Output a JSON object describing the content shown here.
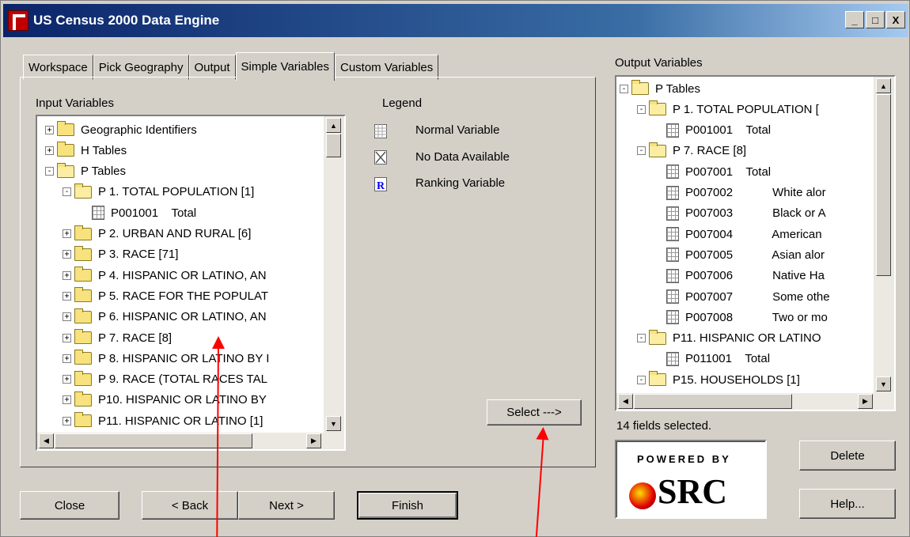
{
  "window": {
    "title": "US Census 2000 Data Engine",
    "btn_min": "_",
    "btn_max": "□",
    "btn_close": "X"
  },
  "tabs": [
    "Workspace",
    "Pick Geography",
    "Output",
    "Simple Variables",
    "Custom Variables"
  ],
  "input_label": "Input Variables",
  "legend": {
    "title": "Legend",
    "items": [
      "Normal Variable",
      "No Data Available",
      "Ranking Variable"
    ]
  },
  "input_tree": [
    {
      "sign": "+",
      "icon": "folder",
      "label": "Geographic Identifiers",
      "lvl": 0
    },
    {
      "sign": "+",
      "icon": "folder",
      "label": "H Tables",
      "lvl": 0
    },
    {
      "sign": "−",
      "icon": "folder-open",
      "label": "P Tables",
      "lvl": 0
    },
    {
      "sign": "−",
      "icon": "folder-open",
      "label": "P 1. TOTAL POPULATION [1]",
      "lvl": 1
    },
    {
      "sign": "",
      "icon": "doc",
      "label": "P001001    Total",
      "lvl": 2
    },
    {
      "sign": "+",
      "icon": "folder",
      "label": "P 2. URBAN AND RURAL [6]",
      "lvl": 1
    },
    {
      "sign": "+",
      "icon": "folder",
      "label": "P 3. RACE [71]",
      "lvl": 1
    },
    {
      "sign": "+",
      "icon": "folder",
      "label": "P 4. HISPANIC OR LATINO, AN",
      "lvl": 1
    },
    {
      "sign": "+",
      "icon": "folder",
      "label": "P 5. RACE FOR THE POPULAT",
      "lvl": 1
    },
    {
      "sign": "+",
      "icon": "folder",
      "label": "P 6. HISPANIC OR LATINO, AN",
      "lvl": 1
    },
    {
      "sign": "+",
      "icon": "folder",
      "label": "P 7. RACE [8]",
      "lvl": 1
    },
    {
      "sign": "+",
      "icon": "folder",
      "label": "P 8. HISPANIC OR LATINO BY I",
      "lvl": 1
    },
    {
      "sign": "+",
      "icon": "folder",
      "label": "P 9. RACE (TOTAL RACES TAL",
      "lvl": 1
    },
    {
      "sign": "+",
      "icon": "folder",
      "label": "P10. HISPANIC OR LATINO BY",
      "lvl": 1
    },
    {
      "sign": "+",
      "icon": "folder",
      "label": "P11. HISPANIC OR LATINO [1]",
      "lvl": 1
    }
  ],
  "output_label": "Output Variables",
  "output_tree": [
    {
      "sign": "−",
      "icon": "folder-open",
      "label": "P Tables",
      "lvl": 0
    },
    {
      "sign": "−",
      "icon": "folder-open",
      "label": "P 1. TOTAL POPULATION [",
      "lvl": 1
    },
    {
      "sign": "",
      "icon": "doc",
      "label": "P001001    Total",
      "lvl": 2
    },
    {
      "sign": "−",
      "icon": "folder-open",
      "label": "P 7. RACE [8]",
      "lvl": 1
    },
    {
      "sign": "",
      "icon": "doc",
      "label": "P007001    Total",
      "lvl": 2
    },
    {
      "sign": "",
      "icon": "doc",
      "label": "P007002            White alor",
      "lvl": 2
    },
    {
      "sign": "",
      "icon": "doc",
      "label": "P007003            Black or A",
      "lvl": 2
    },
    {
      "sign": "",
      "icon": "doc",
      "label": "P007004            American",
      "lvl": 2
    },
    {
      "sign": "",
      "icon": "doc",
      "label": "P007005            Asian alor",
      "lvl": 2
    },
    {
      "sign": "",
      "icon": "doc",
      "label": "P007006            Native Ha",
      "lvl": 2
    },
    {
      "sign": "",
      "icon": "doc",
      "label": "P007007            Some othe",
      "lvl": 2
    },
    {
      "sign": "",
      "icon": "doc",
      "label": "P007008            Two or mo",
      "lvl": 2
    },
    {
      "sign": "−",
      "icon": "folder-open",
      "label": "P11. HISPANIC OR LATINO",
      "lvl": 1
    },
    {
      "sign": "",
      "icon": "doc",
      "label": "P011001    Total",
      "lvl": 2
    },
    {
      "sign": "−",
      "icon": "folder-open",
      "label": "P15. HOUSEHOLDS [1]",
      "lvl": 1
    }
  ],
  "status": "14 fields selected.",
  "buttons": {
    "select": "Select --->",
    "delete": "Delete",
    "help": "Help...",
    "close": "Close",
    "back": "< Back",
    "next": "Next >",
    "finish": "Finish"
  },
  "logo": {
    "powered": "POWERED BY",
    "brand": "SRC"
  }
}
